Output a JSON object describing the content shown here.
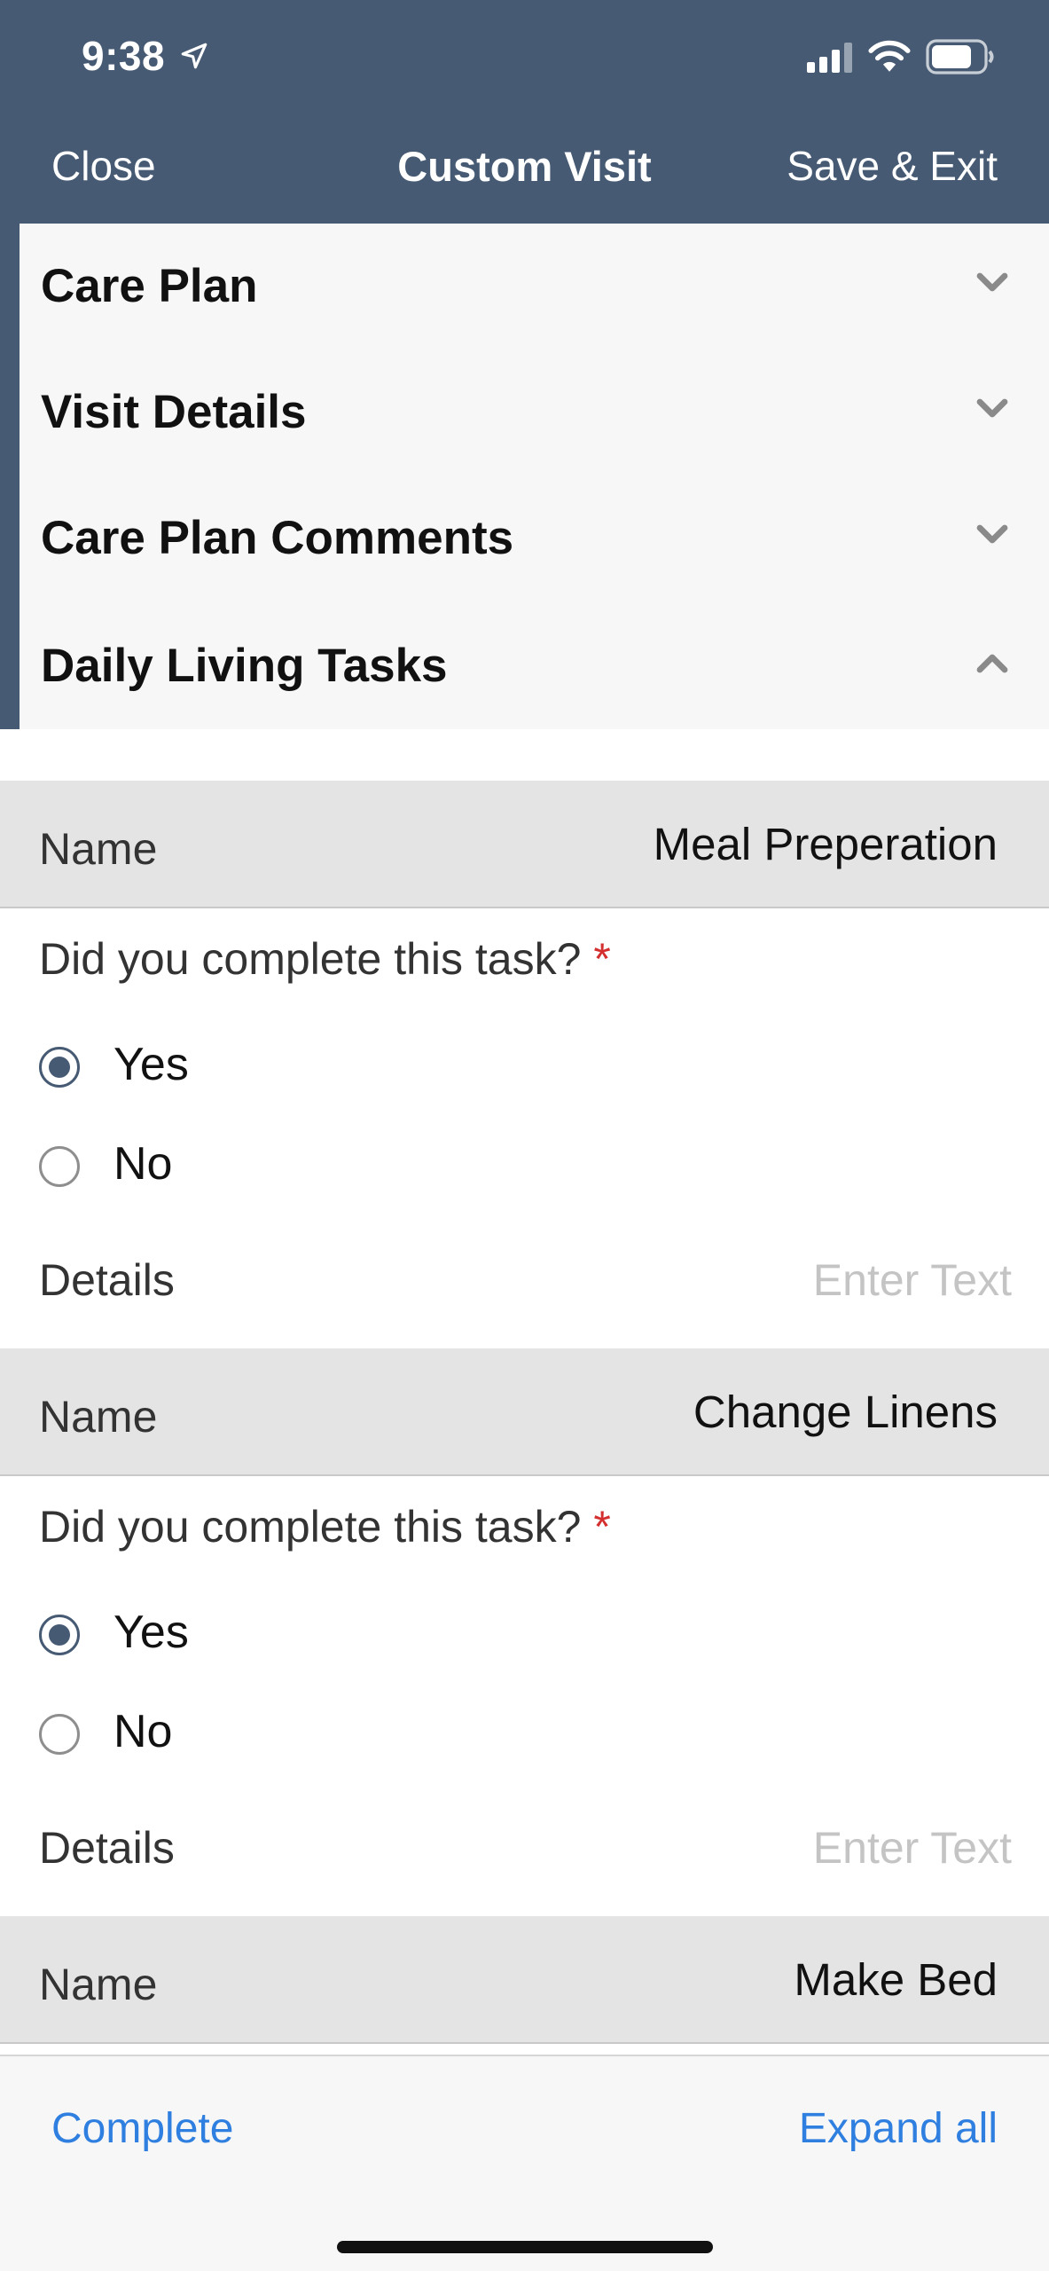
{
  "status_bar": {
    "time": "9:38",
    "icons": [
      "location-arrow-icon",
      "cellular-signal-icon",
      "wifi-icon",
      "battery-icon"
    ]
  },
  "nav": {
    "close_label": "Close",
    "title": "Custom Visit",
    "save_label": "Save & Exit",
    "background_color": "#465a73"
  },
  "sections": [
    {
      "label": "Care Plan",
      "expanded": false
    },
    {
      "label": "Visit Details",
      "expanded": false
    },
    {
      "label": "Care Plan Comments",
      "expanded": false
    },
    {
      "label": "Daily Living Tasks",
      "expanded": true
    }
  ],
  "tasks": [
    {
      "name_label": "Name",
      "name_value": "Meal Preperation",
      "question": "Did you complete this task?",
      "required_marker": "*",
      "options": [
        "Yes",
        "No"
      ],
      "selected": "Yes",
      "details_label": "Details",
      "details_placeholder": "Enter Text",
      "details_value": ""
    },
    {
      "name_label": "Name",
      "name_value": "Change Linens",
      "question": "Did you complete this task?",
      "required_marker": "*",
      "options": [
        "Yes",
        "No"
      ],
      "selected": "Yes",
      "details_label": "Details",
      "details_placeholder": "Enter Text",
      "details_value": ""
    },
    {
      "name_label": "Name",
      "name_value": "Make Bed"
    }
  ],
  "footer": {
    "complete_label": "Complete",
    "expand_all_label": "Expand all",
    "link_color": "#2f7fe0"
  }
}
